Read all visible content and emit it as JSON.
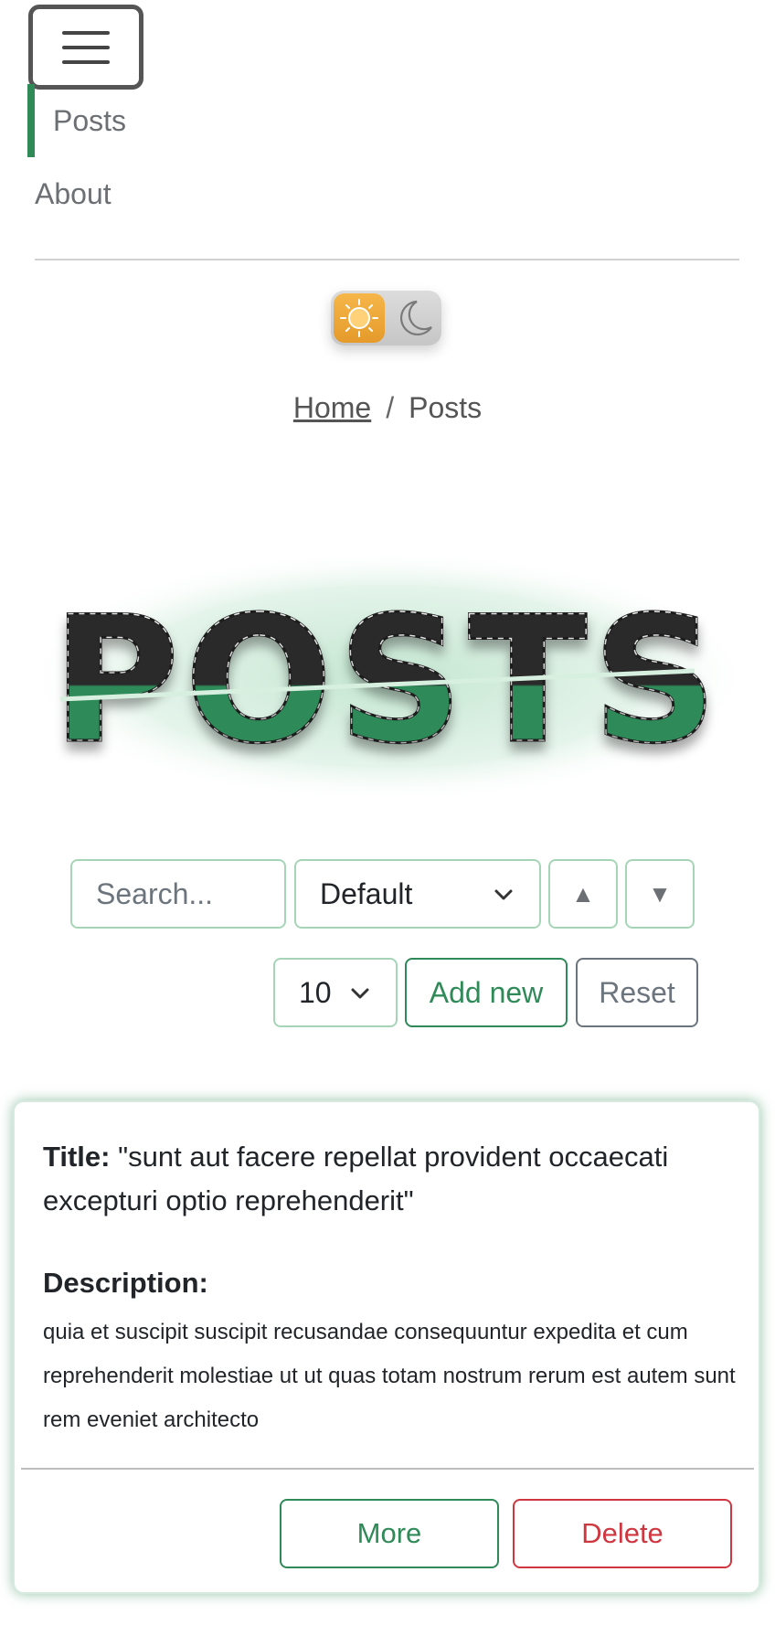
{
  "nav": {
    "items": [
      {
        "label": "Posts",
        "active": true
      },
      {
        "label": "About",
        "active": false
      }
    ]
  },
  "theme_toggle": {
    "state": "light",
    "icons": [
      "sun-icon",
      "moon-icon"
    ]
  },
  "breadcrumb": {
    "home": "Home",
    "separator": "/",
    "current": "Posts"
  },
  "hero": {
    "title": "POSTS"
  },
  "filters": {
    "search_placeholder": "Search...",
    "sort_selected": "Default",
    "asc_symbol": "▲",
    "desc_symbol": "▼",
    "limit_selected": "10",
    "add_new_label": "Add new",
    "reset_label": "Reset"
  },
  "posts": [
    {
      "title_label": "Title:",
      "title": "\"sunt aut facere repellat provident occaecati excepturi optio reprehenderit\"",
      "description_label": "Description:",
      "description": "quia et suscipit suscipit recusandae consequuntur expedita et cum reprehenderit molestiae ut ut quas totam nostrum rerum est autem sunt rem eveniet architecto",
      "more_label": "More",
      "delete_label": "Delete"
    }
  ],
  "colors": {
    "accent": "#2f8a58",
    "danger": "#d0363f",
    "sun": "#f0a93b"
  }
}
